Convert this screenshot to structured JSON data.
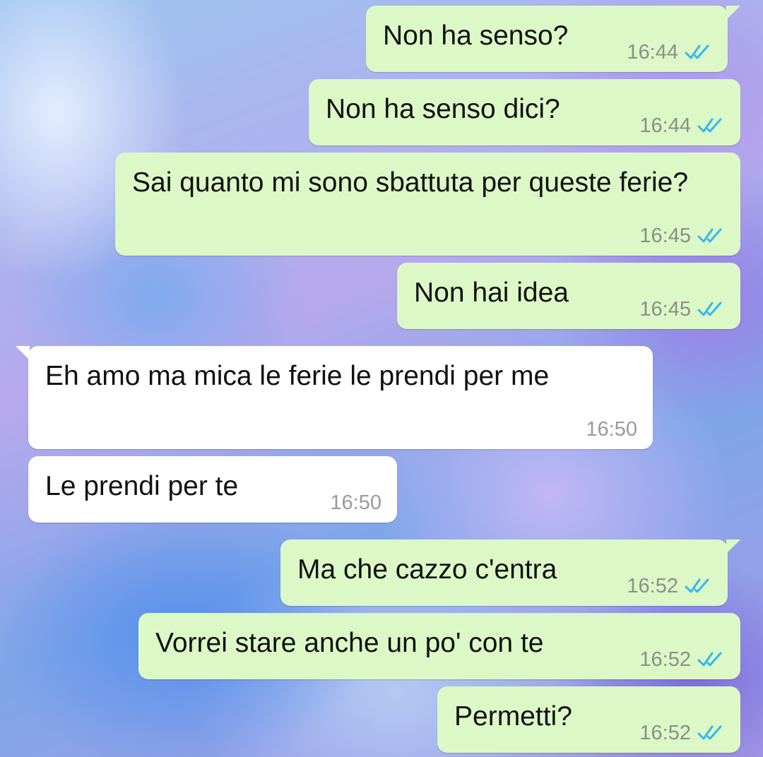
{
  "colors": {
    "outgoing_bubble": "#dcf8c6",
    "incoming_bubble": "#ffffff",
    "read_ticks": "#34b7f1"
  },
  "messages": [
    {
      "text": "Non ha senso?",
      "time": "16:44",
      "direction": "out",
      "status": "read"
    },
    {
      "text": "Non ha senso dici?",
      "time": "16:44",
      "direction": "out",
      "status": "read"
    },
    {
      "text": "Sai quanto mi sono sbattuta per queste ferie?",
      "time": "16:45",
      "direction": "out",
      "status": "read"
    },
    {
      "text": "Non hai idea",
      "time": "16:45",
      "direction": "out",
      "status": "read"
    },
    {
      "text": "Eh amo ma mica le ferie le prendi per me",
      "time": "16:50",
      "direction": "in"
    },
    {
      "text": "Le prendi per te",
      "time": "16:50",
      "direction": "in"
    },
    {
      "text": "Ma che cazzo c'entra",
      "time": "16:52",
      "direction": "out",
      "status": "read"
    },
    {
      "text": "Vorrei stare anche un po' con te",
      "time": "16:52",
      "direction": "out",
      "status": "read"
    },
    {
      "text": "Permetti?",
      "time": "16:52",
      "direction": "out",
      "status": "read"
    }
  ]
}
